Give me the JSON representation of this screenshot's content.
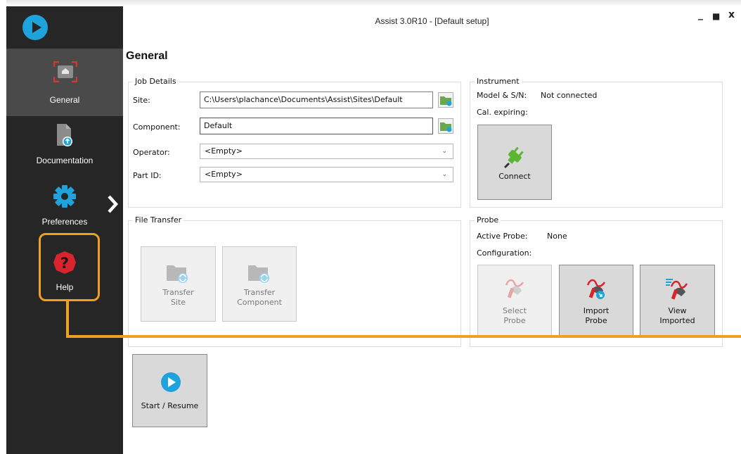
{
  "window": {
    "title": "Assist 3.0R10 - [Default setup]",
    "minimize": "_",
    "maximize": "■",
    "close": "x"
  },
  "sidebar": {
    "logo": "assist-logo-icon",
    "items": [
      {
        "label": "General",
        "icon": "home-icon",
        "selected": true
      },
      {
        "label": "Documentation",
        "icon": "document-icon"
      },
      {
        "label": "Preferences",
        "icon": "gear-icon"
      },
      {
        "label": "Help",
        "icon": "help-icon"
      }
    ],
    "expand_icon": "chevron-right-icon"
  },
  "page": {
    "title": "General"
  },
  "job_details": {
    "title": "Job Details",
    "site_label": "Site:",
    "site_value": "C:\\Users\\plachance\\Documents\\Assist\\Sites\\Default",
    "component_label": "Component:",
    "component_value": "Default",
    "operator_label": "Operator:",
    "operator_value": "<Empty>",
    "partid_label": "Part ID:",
    "partid_value": "<Empty>"
  },
  "instrument": {
    "title": "Instrument",
    "model_label": "Model & S/N:",
    "model_value": "Not connected",
    "cal_label": "Cal. expiring:",
    "connect_label": "Connect"
  },
  "file_transfer": {
    "title": "File Transfer",
    "transfer_site_line1": "Transfer",
    "transfer_site_line2": "Site",
    "transfer_component_line1": "Transfer",
    "transfer_component_line2": "Component"
  },
  "probe": {
    "title": "Probe",
    "active_label": "Active Probe:",
    "active_value": "None",
    "config_label": "Configuration:",
    "select_line1": "Select",
    "select_line2": "Probe",
    "import_line1": "Import",
    "import_line2": "Probe",
    "view_line1": "View",
    "view_line2": "Imported"
  },
  "start": {
    "label": "Start / Resume"
  },
  "colors": {
    "sidebar_bg": "#262626",
    "sidebar_selected": "#4a4a4a",
    "accent_blue": "#1ea3dc",
    "highlight_orange": "#f0a01f",
    "help_red": "#d9232d",
    "connect_green": "#5cb531",
    "folder_green": "#6aa84f"
  }
}
